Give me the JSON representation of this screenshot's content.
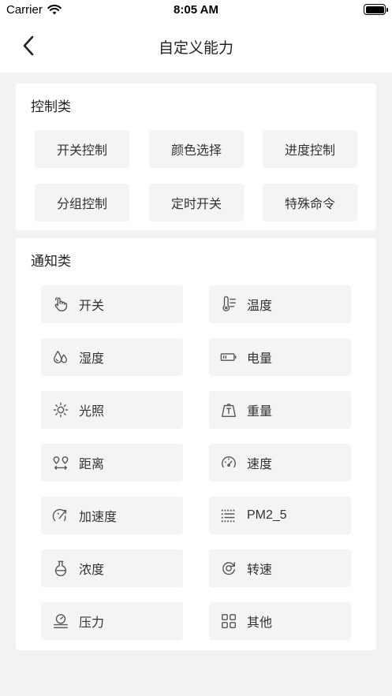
{
  "status_bar": {
    "carrier": "Carrier",
    "time": "8:05 AM"
  },
  "nav": {
    "title": "自定义能力"
  },
  "control_section": {
    "title": "控制类",
    "buttons": [
      "开关控制",
      "颜色选择",
      "进度控制",
      "分组控制",
      "定时开关",
      "特殊命令"
    ]
  },
  "notify_section": {
    "title": "通知类",
    "items": [
      {
        "label": "开关",
        "icon": "hand-pointer-icon"
      },
      {
        "label": "温度",
        "icon": "thermometer-icon"
      },
      {
        "label": "湿度",
        "icon": "droplets-icon"
      },
      {
        "label": "电量",
        "icon": "battery-icon"
      },
      {
        "label": "光照",
        "icon": "sun-icon"
      },
      {
        "label": "重量",
        "icon": "weight-icon"
      },
      {
        "label": "距离",
        "icon": "distance-icon"
      },
      {
        "label": "速度",
        "icon": "speedometer-icon"
      },
      {
        "label": "加速度",
        "icon": "acceleration-icon"
      },
      {
        "label": "PM2_5",
        "icon": "particles-icon"
      },
      {
        "label": "浓度",
        "icon": "flask-icon"
      },
      {
        "label": "转速",
        "icon": "rotation-icon"
      },
      {
        "label": "压力",
        "icon": "pressure-gauge-icon"
      },
      {
        "label": "其他",
        "icon": "grid-icon"
      }
    ]
  },
  "colors": {
    "background": "#f2f2f4",
    "card": "#ffffff",
    "button": "#f4f4f6",
    "text": "#333333"
  }
}
